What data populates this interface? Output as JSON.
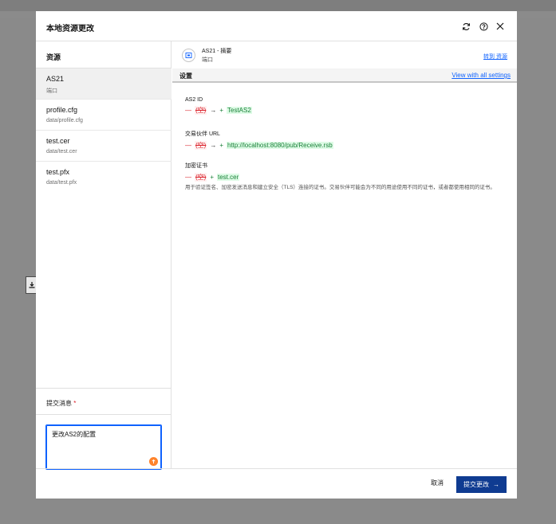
{
  "dialog": {
    "title": "本地资源更改"
  },
  "resources": {
    "heading": "资源",
    "items": [
      {
        "name": "AS21",
        "sub": "端口"
      },
      {
        "name": "profile.cfg",
        "sub": "data/profile.cfg"
      },
      {
        "name": "test.cer",
        "sub": "data/test.cer"
      },
      {
        "name": "test.pfx",
        "sub": "data/test.pfx"
      }
    ]
  },
  "commit": {
    "label": "提交消息",
    "required_mark": "*",
    "value": "更改AS2的配置"
  },
  "summary": {
    "title": "AS21 - 摘要",
    "subtitle": "端口",
    "goto_link": "转到 资源"
  },
  "settings": {
    "heading": "设置",
    "view_all": "View with all settings",
    "fields": [
      {
        "label": "AS2 ID",
        "old_marker": "—",
        "old": "(空)",
        "arrow": "→",
        "new_marker": "+",
        "new": "TestAS2"
      },
      {
        "label": "交易伙伴 URL",
        "old_marker": "—",
        "old": "(空)",
        "arrow": "→",
        "new_marker": "+",
        "new": "http://localhost:8080/pub/Receive.rsb"
      },
      {
        "label": "加密证书",
        "old_marker": "—",
        "old": "(空)",
        "new_marker": "+",
        "new": "test.cer",
        "description": "用于验证签名、加密发送消息和建立安全（TLS）连接的证书。交易伙伴可能会为不同的用途使用不同的证书，或者都使用相同的证书。"
      }
    ]
  },
  "footer": {
    "cancel": "取消",
    "submit": "提交更改",
    "submit_arrow": "→"
  },
  "colors": {
    "primary": "#0f3b91",
    "link": "#0f62fe",
    "removed": "#da1e28",
    "added": "#198038",
    "warning": "#ff832b"
  }
}
